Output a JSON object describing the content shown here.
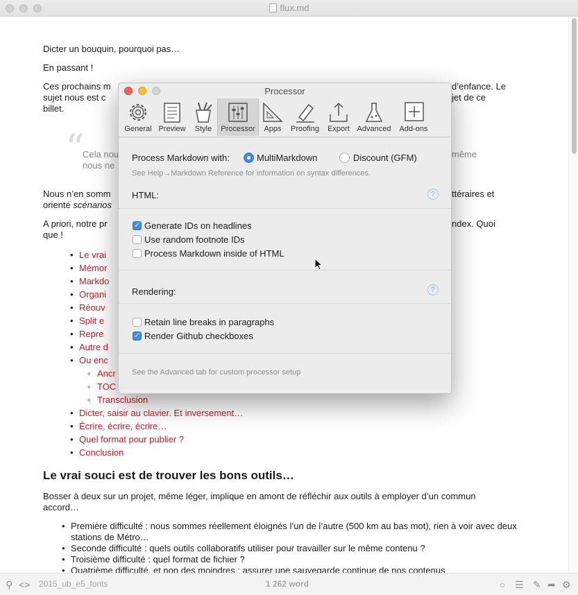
{
  "window": {
    "title": "flux.md"
  },
  "document": {
    "paragraphs": [
      "Dicter un bouquin, pourquoi pas…",
      "En passant !"
    ],
    "para3": {
      "start": "Ces prochains m",
      "end1": "d’enfance. Le",
      "line2start": "sujet nous est c",
      "line2end": "jet de ce",
      "line3": "billet."
    },
    "quote": {
      "line1a": "Cela nou",
      "line1b": "même",
      "line2": "nous ne"
    },
    "para4": {
      "line1start": "Nous n’en somm",
      "line1end": "ttéraires et",
      "line2start": "orienté ",
      "line2italic": "scénarios"
    },
    "para5": {
      "line1start": "A priori, notre pr",
      "line1end": "ndex. Quoi",
      "line2": "que !"
    },
    "toc": [
      "Le vrai",
      "Mémor",
      "Markdo",
      "Organi",
      "Réouv",
      "Split e",
      "Repre",
      "Autre d",
      "Ou enc"
    ],
    "toc_sub": [
      "Ancr",
      "TOC",
      "Transclusion"
    ],
    "toc_rest": [
      "Dicter, saisir au clavier. Et inversement…",
      "Écrire, écrire, écrire…",
      "Quel format pour publier ?",
      "Conclusion"
    ],
    "heading": "Le vrai souci est de trouver les bons outils…",
    "para6": "Bosser à deux sur un projet, même léger, implique en amont de réfléchir aux outils à employer d’un commun accord…",
    "bullets": [
      "Première difficulté : nous sommes réellement éloignés l’un de l’autre (500 km au bas mot), rien à voir avec deux stations de Métro…",
      "Seconde difficulté : quels outils collaboratifs utiliser pour travailler sur le même contenu ?",
      "Troisième difficulté : quel format de fichier ?",
      "Quatrième difficulté, et non des moindres : assurer une sauvegarde continue de nos contenus"
    ]
  },
  "statusbar": {
    "filename": "2015_ub_e5_fonts",
    "word_count": "1 262 word"
  },
  "dialog": {
    "title": "Processor",
    "tabs": [
      "General",
      "Preview",
      "Style",
      "Processor",
      "Apps",
      "Proofing",
      "Export",
      "Advanced",
      "Add-ons"
    ],
    "selected_tab": "Processor",
    "process_label": "Process Markdown with:",
    "radio_options": [
      {
        "label": "MultiMarkdown",
        "checked": true
      },
      {
        "label": "Discount (GFM)",
        "checked": false
      }
    ],
    "help_text": "See Help→Markdown Reference for information on syntax differences.",
    "html_section": "HTML:",
    "html_options": [
      {
        "label": "Generate IDs on headlines",
        "checked": true
      },
      {
        "label": "Use random footnote IDs",
        "checked": false
      },
      {
        "label": "Process Markdown inside of HTML",
        "checked": false
      }
    ],
    "rendering_section": "Rendering:",
    "rendering_options": [
      {
        "label": "Retain line breaks in paragraphs",
        "checked": false
      },
      {
        "label": "Render Github checkboxes",
        "checked": true
      }
    ],
    "footer_text": "See the Advanced tab for custom processor setup",
    "help_glyph": "?"
  },
  "colors": {
    "accent": "#3b8de8",
    "link_red": "#c71c24"
  }
}
